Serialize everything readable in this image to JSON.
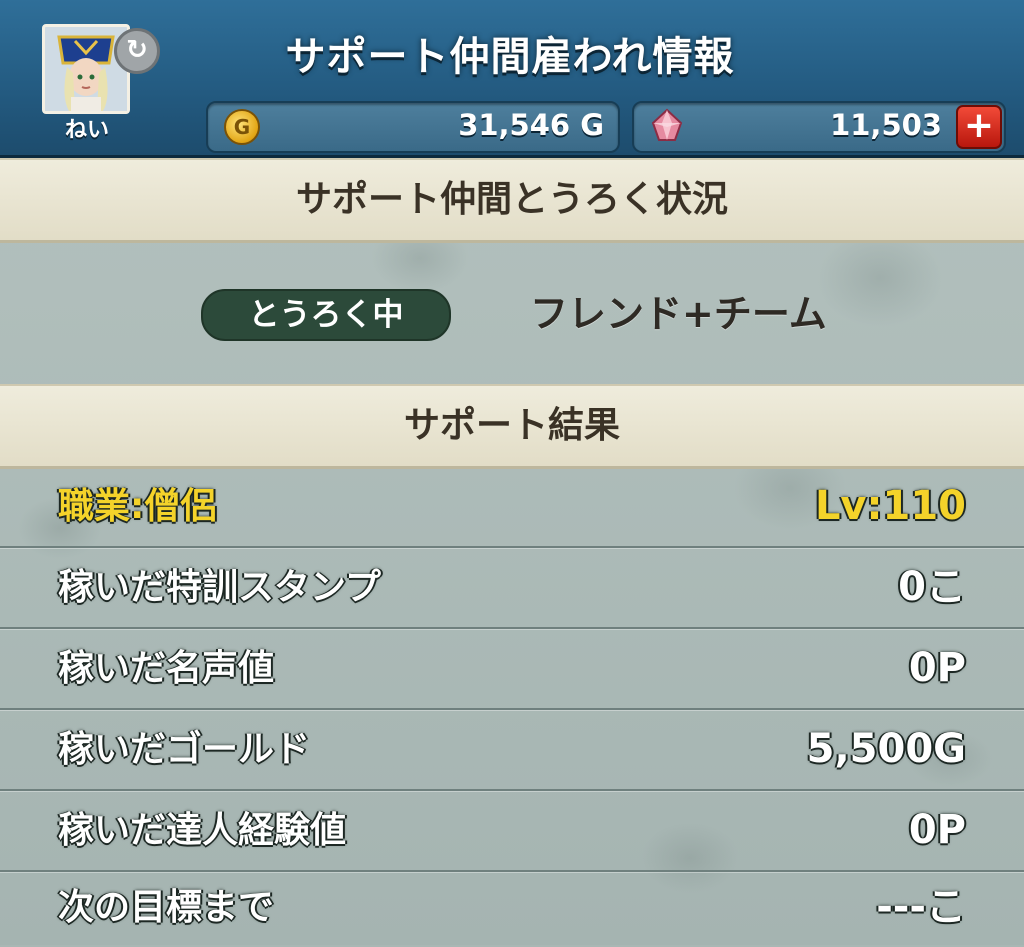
{
  "header": {
    "title": "サポート仲間雇われ情報",
    "player_name": "ねい",
    "refresh_icon": "refresh-icon",
    "gold": "31,546 G",
    "gems": "11,503",
    "add_label": "+"
  },
  "registration": {
    "heading": "サポート仲間とうろく状況",
    "status_badge": "とうろく中",
    "status_value": "フレンド+チーム"
  },
  "results": {
    "heading": "サポート結果",
    "job_label": "職業:僧侶",
    "level": "Lv:110",
    "rows": [
      {
        "label": "稼いだ特訓スタンプ",
        "value": "0こ"
      },
      {
        "label": "稼いだ名声値",
        "value": "0P"
      },
      {
        "label": "稼いだゴールド",
        "value": "5,500G"
      },
      {
        "label": "稼いだ達人経験値",
        "value": "0P"
      },
      {
        "label": "次の目標まで",
        "value": "---こ"
      }
    ]
  },
  "colors": {
    "header_blue": "#2f6f99",
    "highlight_yellow": "#f4d32a",
    "badge_green": "#2c4a3a",
    "plus_red": "#d52a1c"
  }
}
